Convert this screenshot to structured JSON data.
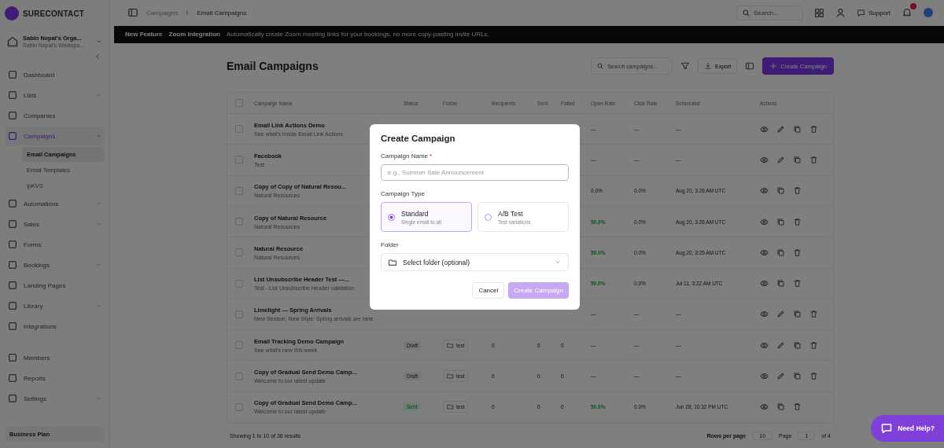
{
  "brand": {
    "name": "SURECONTACT"
  },
  "workspace": {
    "name": "Sabin Nepal's Orga...",
    "subtitle": "Sabin Nepal's Workspa..."
  },
  "sidebar": {
    "items": [
      {
        "label": "Dashboard",
        "selected": false,
        "expandable": false
      },
      {
        "label": "Lists",
        "selected": false,
        "expandable": true
      },
      {
        "label": "Companies",
        "selected": false,
        "expandable": false
      },
      {
        "label": "Campaigns",
        "selected": true,
        "expandable": true,
        "children": [
          {
            "label": "Email Campaigns",
            "selected": true
          },
          {
            "label": "Email Templates",
            "selected": false
          },
          {
            "label": "ipKVS",
            "selected": false
          }
        ]
      },
      {
        "label": "Automations",
        "selected": false,
        "expandable": true
      },
      {
        "label": "Sales",
        "selected": false,
        "expandable": true
      },
      {
        "label": "Forms",
        "selected": false,
        "expandable": false
      },
      {
        "label": "Bookings",
        "selected": false,
        "expandable": true
      },
      {
        "label": "Landing Pages",
        "selected": false,
        "expandable": false
      },
      {
        "label": "Library",
        "selected": false,
        "expandable": true
      },
      {
        "label": "Integrations",
        "selected": false,
        "expandable": false
      }
    ],
    "footer_items": [
      {
        "label": "Members",
        "expandable": false
      },
      {
        "label": "Reports",
        "expandable": false
      },
      {
        "label": "Settings",
        "expandable": true
      }
    ],
    "plan": "Business Plan"
  },
  "breadcrumb": [
    "Campaigns",
    "Email Campaigns"
  ],
  "topbar": {
    "search_placeholder": "Search...",
    "support": "Support"
  },
  "banner": {
    "tag": "New Feature",
    "title": "Zoom Integration",
    "text": "Automatically create Zoom meeting links for your bookings, no more copy-pasting invite URLs."
  },
  "page": {
    "title": "Email Campaigns",
    "search_placeholder": "Search campaigns...",
    "export": "Export",
    "create": "Create Campaign"
  },
  "table": {
    "columns": [
      "Campaign Name",
      "Status",
      "Folder",
      "Recipients",
      "Sent",
      "Failed",
      "Open Rate",
      "Click Rate",
      "Scheduled",
      "Actions"
    ],
    "select_all_checked": false,
    "rows": [
      {
        "checked": false,
        "name": "Email Link Actions Demo",
        "subtitle": "See what's inside Email Link Actions",
        "open_rate": "—",
        "click_rate": "—",
        "scheduled": "—",
        "open_highlight": false,
        "actions": [
          {
            "kind": "view"
          },
          {
            "kind": "edit"
          },
          {
            "kind": "copy"
          },
          {
            "kind": "delete"
          }
        ]
      },
      {
        "checked": false,
        "name": "Facebook",
        "subtitle": "Test",
        "open_rate": "—",
        "click_rate": "—",
        "scheduled": "—",
        "open_highlight": false,
        "actions": [
          {
            "kind": "view"
          },
          {
            "kind": "edit"
          },
          {
            "kind": "copy"
          },
          {
            "kind": "delete"
          }
        ]
      },
      {
        "checked": false,
        "name": "Copy of Copy of Natural Resou...",
        "subtitle": "Natural Resources",
        "open_rate": "0.0%",
        "click_rate": "0.0%",
        "scheduled": "Aug 20, 3:26 AM UTC",
        "open_highlight": false,
        "actions": [
          {
            "kind": "view"
          },
          {
            "kind": "copy"
          },
          {
            "kind": "delete"
          }
        ]
      },
      {
        "checked": false,
        "name": "Copy of Natural Resource",
        "subtitle": "Natural Resources",
        "open_rate": "50.0%",
        "click_rate": "0.0%",
        "scheduled": "Aug 20, 3:26 AM UTC",
        "open_highlight": true,
        "actions": [
          {
            "kind": "view"
          },
          {
            "kind": "copy"
          },
          {
            "kind": "delete"
          }
        ]
      },
      {
        "checked": false,
        "name": "Natural Resource",
        "subtitle": "Natural Resources",
        "open_rate": "50.0%",
        "click_rate": "0.0%",
        "scheduled": "Aug 20, 3:25 AM UTC",
        "open_highlight": true,
        "actions": [
          {
            "kind": "view"
          },
          {
            "kind": "copy"
          },
          {
            "kind": "delete"
          }
        ]
      },
      {
        "checked": false,
        "name": "List Unsubscribe Header Test —...",
        "subtitle": "Test - List Unsubscribe Header validation",
        "open_rate": "50.0%",
        "click_rate": "0.0%",
        "scheduled": "Jul 11, 3:22 AM UTC",
        "open_highlight": true,
        "actions": [
          {
            "kind": "view"
          },
          {
            "kind": "copy"
          },
          {
            "kind": "delete"
          }
        ]
      },
      {
        "checked": false,
        "name": "Limelight — Spring Arrivals",
        "subtitle": "New Season, New Style: Spring arrivals are here",
        "open_rate": "—",
        "click_rate": "—",
        "scheduled": "—",
        "open_highlight": false,
        "actions": [
          {
            "kind": "view"
          },
          {
            "kind": "edit"
          },
          {
            "kind": "copy"
          },
          {
            "kind": "delete"
          }
        ]
      },
      {
        "checked": false,
        "name": "Email Tracking Demo Campaign",
        "subtitle": "See what's new this week",
        "status": "Draft",
        "status_sent": false,
        "folder": "test",
        "recipients": "0",
        "sent": "0",
        "failed": "0",
        "open_rate": "—",
        "click_rate": "—",
        "scheduled": "—",
        "open_highlight": false,
        "actions": [
          {
            "kind": "view"
          },
          {
            "kind": "edit"
          },
          {
            "kind": "copy"
          },
          {
            "kind": "delete"
          }
        ]
      },
      {
        "checked": false,
        "name": "Copy of Gradual Send Demo Camp...",
        "subtitle": "Welcome to our latest update",
        "status": "Draft",
        "status_sent": false,
        "folder": "test",
        "recipients": "0",
        "sent": "0",
        "failed": "0",
        "open_rate": "—",
        "click_rate": "—",
        "scheduled": "—",
        "open_highlight": false,
        "actions": [
          {
            "kind": "view"
          },
          {
            "kind": "edit"
          },
          {
            "kind": "copy"
          },
          {
            "kind": "delete"
          }
        ]
      },
      {
        "checked": false,
        "name": "Copy of Gradual Send Demo Camp...",
        "subtitle": "Welcome to our latest update",
        "status": "Sent",
        "status_sent": true,
        "folder": "test",
        "recipients": "0",
        "sent": "0",
        "failed": "0",
        "open_rate": "50.0%",
        "click_rate": "0.0%",
        "scheduled": "Jun 28, 10:32 PM UTC",
        "open_highlight": true,
        "actions": [
          {
            "kind": "view"
          },
          {
            "kind": "copy"
          },
          {
            "kind": "delete"
          }
        ]
      }
    ]
  },
  "pagination": {
    "summary": "Showing 1 to 10 of 36 results",
    "rows_label": "Rows per page",
    "rows_value": "10",
    "page_label": "Page",
    "page": "1",
    "of": "of 4"
  },
  "dialog": {
    "title": "Create Campaign",
    "name_label": "Campaign Name",
    "required": "*",
    "name_placeholder": "e.g., Summer Sale Announcement",
    "type_label": "Campaign Type",
    "types": [
      {
        "title": "Standard",
        "description": "Single email to all",
        "selected": true
      },
      {
        "title": "A/B Test",
        "description": "Test variations",
        "selected": false
      }
    ],
    "folder_label": "Folder",
    "folder_placeholder": "Select folder (optional)",
    "cancel": "Cancel",
    "submit": "Create Campaign",
    "submit_disabled": true
  },
  "help": {
    "label": "Need Help?"
  }
}
